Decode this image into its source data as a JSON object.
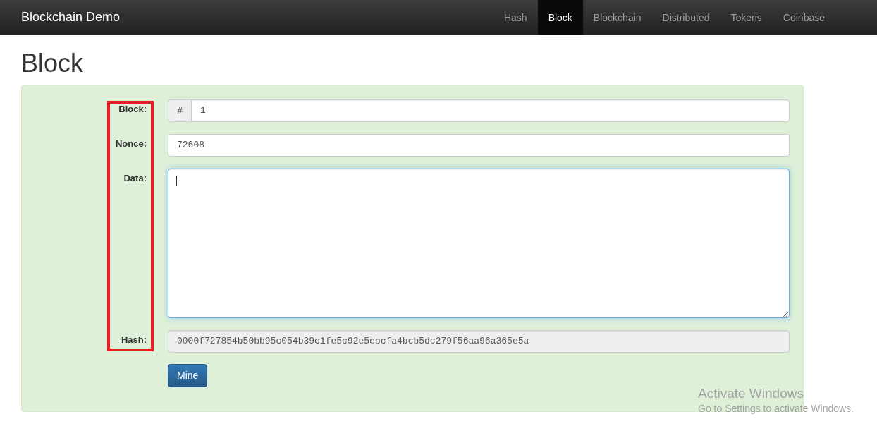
{
  "navbar": {
    "brand": "Blockchain Demo",
    "items": [
      {
        "label": "Hash",
        "selected": false
      },
      {
        "label": "Block",
        "selected": true
      },
      {
        "label": "Blockchain",
        "selected": false
      },
      {
        "label": "Distributed",
        "selected": false
      },
      {
        "label": "Tokens",
        "selected": false
      },
      {
        "label": "Coinbase",
        "selected": false
      }
    ]
  },
  "heading": "Block",
  "form": {
    "fields": [
      {
        "kind": "addon-input",
        "label": "Block:",
        "addon": "#",
        "value": "1"
      },
      {
        "kind": "input",
        "label": "Nonce:",
        "value": "72608"
      },
      {
        "kind": "textarea",
        "label": "Data:",
        "focused": true
      },
      {
        "kind": "readonly",
        "label": "Hash:",
        "value": "0000f727854b50bb95c054b39c1fe5c92e5ebcfa4bcb5dc279f56aa96a365e5a"
      }
    ],
    "button": "Mine"
  },
  "os_notice": {
    "title": "Activate Windows",
    "subtitle": "Go to Settings to activate Windows."
  }
}
